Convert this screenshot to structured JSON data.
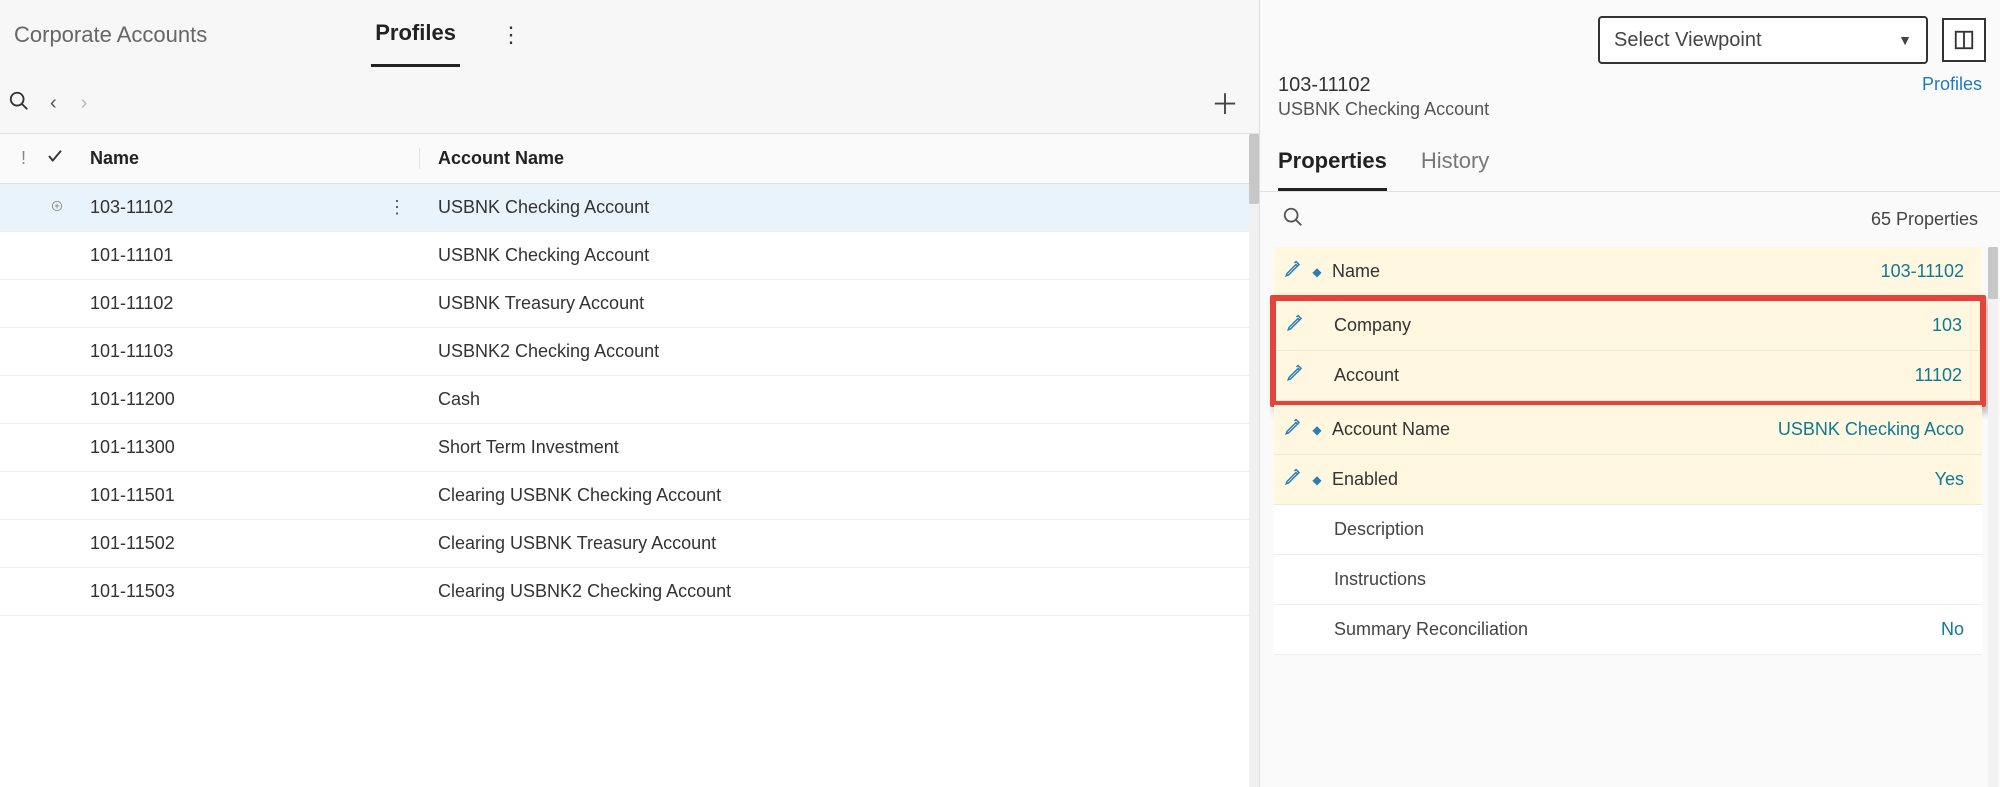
{
  "top_tabs": {
    "corporate": "Corporate Accounts",
    "profiles": "Profiles"
  },
  "grid": {
    "headers": {
      "name": "Name",
      "account_name": "Account Name"
    },
    "rows": [
      {
        "code": "103-11102",
        "account": "USBNK Checking Account",
        "selected": true
      },
      {
        "code": "101-11101",
        "account": "USBNK Checking Account"
      },
      {
        "code": "101-11102",
        "account": "USBNK Treasury Account"
      },
      {
        "code": "101-11103",
        "account": "USBNK2 Checking Account"
      },
      {
        "code": "101-11200",
        "account": "Cash"
      },
      {
        "code": "101-11300",
        "account": "Short Term Investment"
      },
      {
        "code": "101-11501",
        "account": "Clearing USBNK Checking Account"
      },
      {
        "code": "101-11502",
        "account": "Clearing USBNK Treasury Account"
      },
      {
        "code": "101-11503",
        "account": "Clearing USBNK2 Checking Account"
      }
    ]
  },
  "viewpoint": {
    "placeholder": "Select Viewpoint"
  },
  "detail": {
    "code": "103-11102",
    "name": "USBNK Checking Account",
    "profiles_link": "Profiles",
    "tabs": {
      "properties": "Properties",
      "history": "History"
    },
    "count_label": "65 Properties",
    "properties": [
      {
        "label": "Name",
        "value": "103-11102",
        "pencil": true,
        "bullet": true,
        "highlighted": false
      },
      {
        "label": "Company",
        "value": "103",
        "pencil": true,
        "bullet": false,
        "highlighted": true
      },
      {
        "label": "Account",
        "value": "11102",
        "pencil": true,
        "bullet": false,
        "highlighted": true
      },
      {
        "label": "Account Name",
        "value": "USBNK Checking Acco",
        "pencil": true,
        "bullet": true,
        "highlighted": false
      },
      {
        "label": "Enabled",
        "value": "Yes",
        "pencil": true,
        "bullet": true,
        "highlighted": false
      },
      {
        "label": "Description",
        "value": "",
        "plain": true
      },
      {
        "label": "Instructions",
        "value": "",
        "plain": true
      },
      {
        "label": "Summary Reconciliation",
        "value": "No",
        "plain": true
      }
    ]
  }
}
